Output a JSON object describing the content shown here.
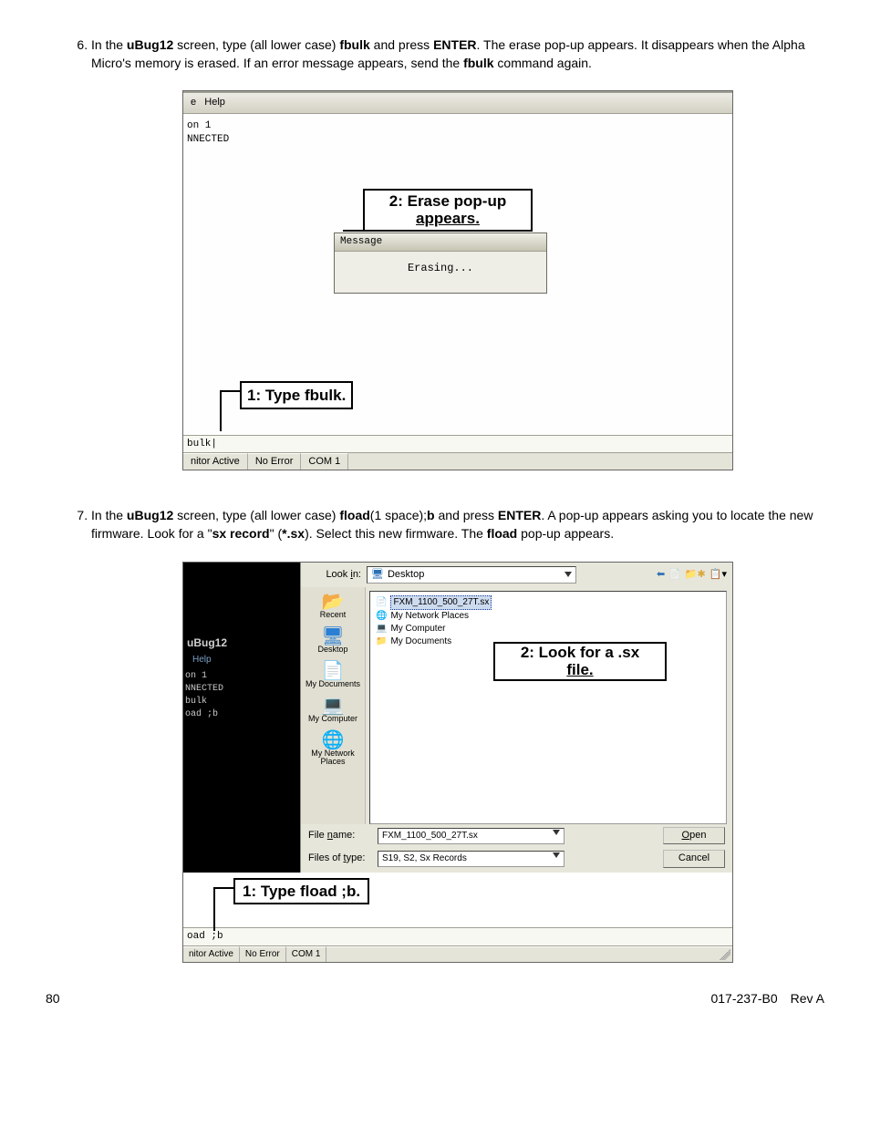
{
  "steps": {
    "six": {
      "number": "6.",
      "text_pre": "In the ",
      "app": "uBug12",
      "text_mid1": " screen, type (all lower case) ",
      "cmd": "fbulk",
      "text_mid2": " and press ",
      "enter": "ENTER",
      "text_mid3": ". The erase pop-up appears. It disappears when the Alpha Micro's memory is erased. If an error message appears, send the ",
      "cmd2": "fbulk",
      "text_end": " command again."
    },
    "seven": {
      "number": "7.",
      "text_pre": "In the ",
      "app": "uBug12",
      "text_mid1": " screen, type (all lower case) ",
      "cmd": "fload",
      "text_mid1b": "(1 space);",
      "cmd_b": "b",
      "text_mid2": " and press ",
      "enter": "ENTER",
      "text_mid3": ". A pop-up appears asking you to locate the new firmware. Look for a \"",
      "sxrec": "sx record",
      "text_mid4": "\" (",
      "sxext": "*.sx",
      "text_mid5": "). Select this new firmware. The ",
      "cmd2": "fload",
      "text_end": " pop-up appears."
    }
  },
  "shot1": {
    "menubar_e": "e",
    "menubar_help": "Help",
    "term_line1": "on 1",
    "term_line2": "NNECTED",
    "callout_erase": "2: Erase pop-up\nappears.",
    "msg_title": "Message",
    "msg_body": "Erasing...",
    "callout_type": "1: Type fbulk.",
    "cmdline": "bulk|",
    "status1": "nitor Active",
    "status2": "No Error",
    "status3": "COM 1"
  },
  "shot2": {
    "app_title": "uBug12",
    "help": "Help",
    "term1": "on 1",
    "term2": "NNECTED",
    "term3": "bulk",
    "term4": "oad ;b",
    "lookin_label": "Look in:",
    "lookin_value": "Desktop",
    "filelist": {
      "f1": "FXM_1100_500_27T.sx",
      "f2": "My Network Places",
      "f3": "My Computer",
      "f4": "My Documents"
    },
    "places": {
      "recent": "Recent",
      "desktop": "Desktop",
      "mydocs": "My Documents",
      "mycomp": "My Computer",
      "mynet": "My Network\nPlaces"
    },
    "callout_look": "2: Look for a .sx\nfile.",
    "filename_label": "File name:",
    "filename_value": "FXM_1100_500_27T.sx",
    "filetype_label": "Files of type:",
    "filetype_value": "S19, S2, Sx Records",
    "btn_open": "Open",
    "btn_cancel": "Cancel",
    "callout_type": "1: Type fload ;b.",
    "cmdline": "oad ;b",
    "status1": "nitor Active",
    "status2": "No Error",
    "status3": "COM 1"
  },
  "footer": {
    "page": "80",
    "docrev": "017-237-B0 Rev A"
  }
}
